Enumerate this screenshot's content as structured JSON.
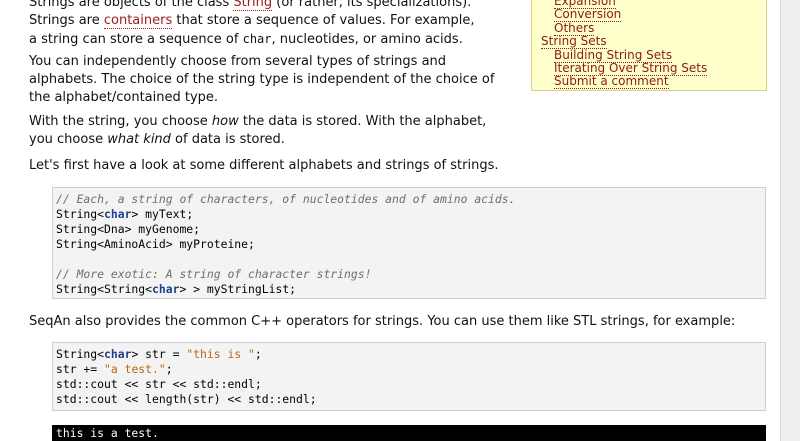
{
  "intro": {
    "line1_a": "Strings are objects of the class ",
    "line1_link": "String",
    "line1_b": " (or rather, its specializations).",
    "line2_a": "Strings are ",
    "line2_link": "containers",
    "line2_b": " that store a sequence of values. For example,",
    "line3_a": "a string can store a sequence of ",
    "line3_code": "char",
    "line3_b": ", nucleotides, or amino acids."
  },
  "para_types": {
    "line1": "You can independently choose from several types of strings and",
    "line2": "alphabets. The choice of the string type is independent of the choice of",
    "line3": "the alphabet/contained type."
  },
  "para_how": {
    "line1_a": "With the string, you choose ",
    "line1_em": "how",
    "line1_b": " the data is stored. With the alphabet,",
    "line2_a": "you choose ",
    "line2_em": "what kind",
    "line2_b": " of data is stored."
  },
  "para_first": "Let's first have a look at some different alphabets and strings of strings.",
  "code1": {
    "comment1": "// Each, a string of characters, of nucleotides and of amino acids.",
    "l1_a": "String<",
    "l1_kw": "char",
    "l1_b": "> myText;",
    "l2": "String<Dna> myGenome;",
    "l3": "String<AminoAcid> myProteine;",
    "comment2": "// More exotic: A string of character strings!",
    "l4_a": "String<String<",
    "l4_kw": "char",
    "l4_b": "> > myStringList;"
  },
  "para_ops": "SeqAn also provides the common C++ operators for strings. You can use them like STL strings, for example:",
  "code2": {
    "l1_a": "String<",
    "l1_kw": "char",
    "l1_b": "> str = ",
    "l1_str": "\"this is \"",
    "l1_c": ";",
    "l2_a": "str += ",
    "l2_str": "\"a test.\"",
    "l2_b": ";",
    "l3": "std::cout << str << std::endl;",
    "l4": "std::cout << length(str) << std::endl;"
  },
  "output": {
    "line1": "this is a test."
  },
  "toc": {
    "items": [
      {
        "label": "Expansion",
        "level": 2
      },
      {
        "label": "Conversion",
        "level": 2
      },
      {
        "label": "Others",
        "level": 2
      },
      {
        "label": "String Sets",
        "level": 1
      },
      {
        "label": "Building String Sets",
        "level": 2
      },
      {
        "label": "Iterating Over String Sets",
        "level": 2
      },
      {
        "label": "Submit a comment",
        "level": 2
      }
    ]
  },
  "colors": {
    "link": "#a01b1b",
    "toc_background": "#ffffcc",
    "code_background": "#f3f3f3",
    "keyword": "#1d3f8c",
    "string_literal": "#b56a12",
    "comment": "#6e6e6e",
    "output_background": "#000000"
  }
}
